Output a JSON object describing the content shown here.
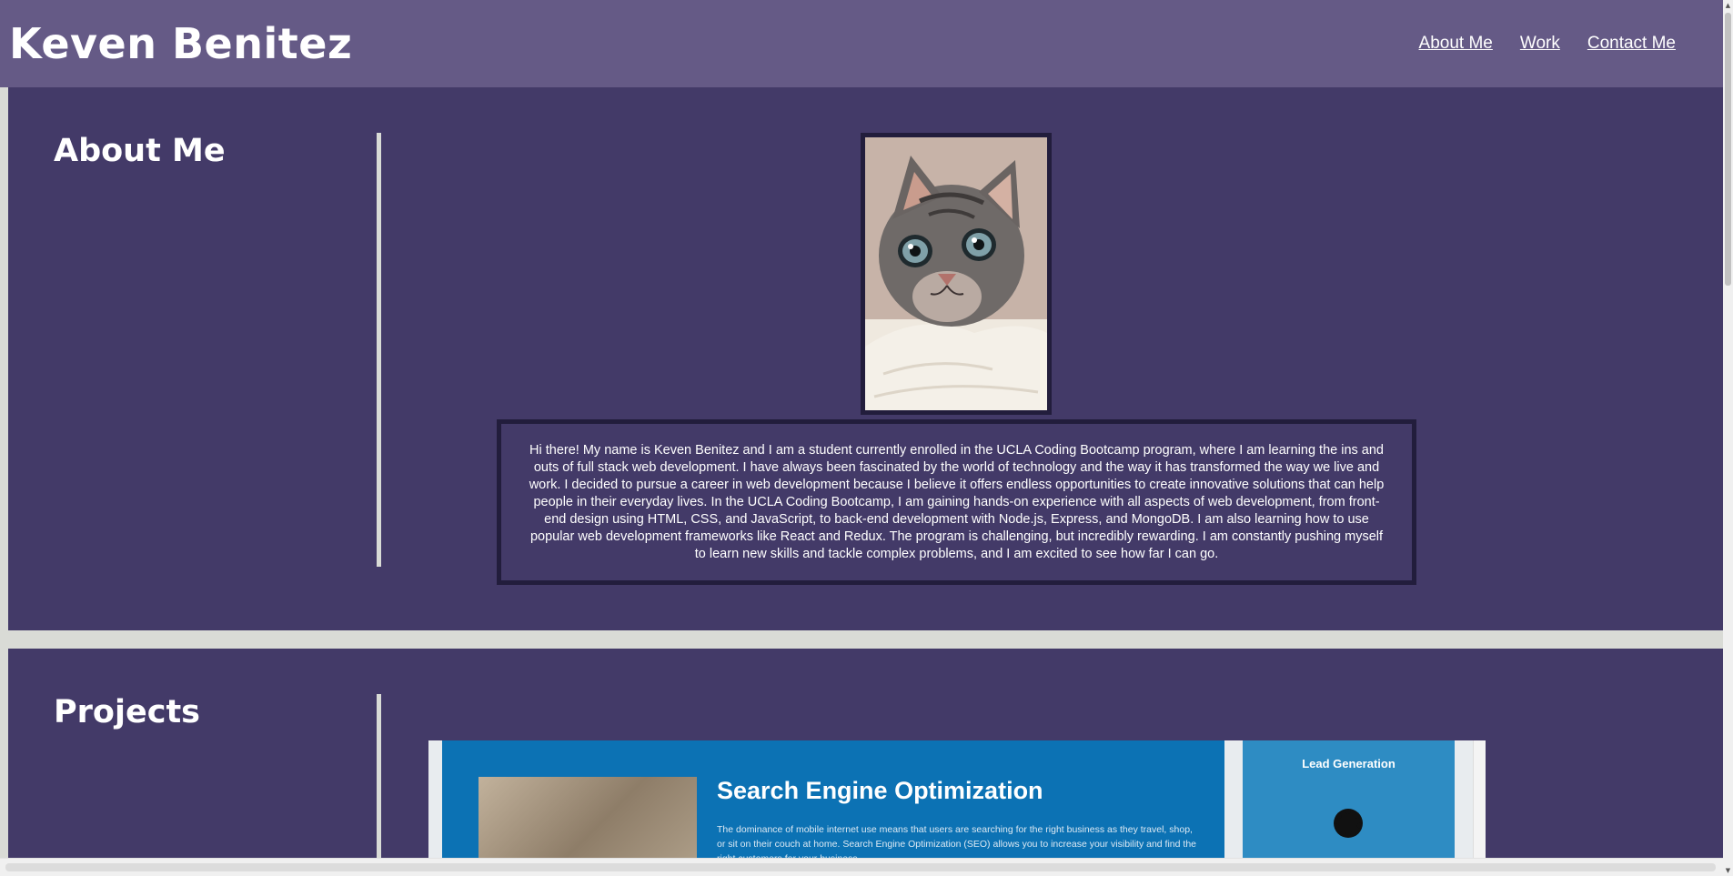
{
  "header": {
    "site_title": "Keven Benitez",
    "nav": [
      {
        "label": "About Me"
      },
      {
        "label": "Work"
      },
      {
        "label": "Contact Me"
      }
    ]
  },
  "about": {
    "heading": "About Me",
    "photo_subject": "kitten photo",
    "bio": "Hi there! My name is Keven Benitez and I am a student currently enrolled in the UCLA Coding Bootcamp program, where I am learning the ins and outs of full stack web development. I have always been fascinated by the world of technology and the way it has transformed the way we live and work. I decided to pursue a career in web development because I believe it offers endless opportunities to create innovative solutions that can help people in their everyday lives. In the UCLA Coding Bootcamp, I am gaining hands-on experience with all aspects of web development, from front-end design using HTML, CSS, and JavaScript, to back-end development with Node.js, Express, and MongoDB. I am also learning how to use popular web development frameworks like React and Redux. The program is challenging, but incredibly rewarding. I am constantly pushing myself to learn new skills and tackle complex problems, and I am excited to see how far I can go."
  },
  "projects": {
    "heading": "Projects",
    "preview": {
      "title": "Search Engine Optimization",
      "text": "The dominance of mobile internet use means that users are searching for the right business as they travel, shop, or sit on their couch at home. Search Engine Optimization (SEO) allows you to increase your visibility and find the right customers for your business.",
      "side_title": "Lead Generation"
    }
  },
  "colors": {
    "header_bg": "#655a86",
    "section_bg": "#433a68",
    "page_bg": "#d9dbd6",
    "frame": "#221d3c"
  }
}
